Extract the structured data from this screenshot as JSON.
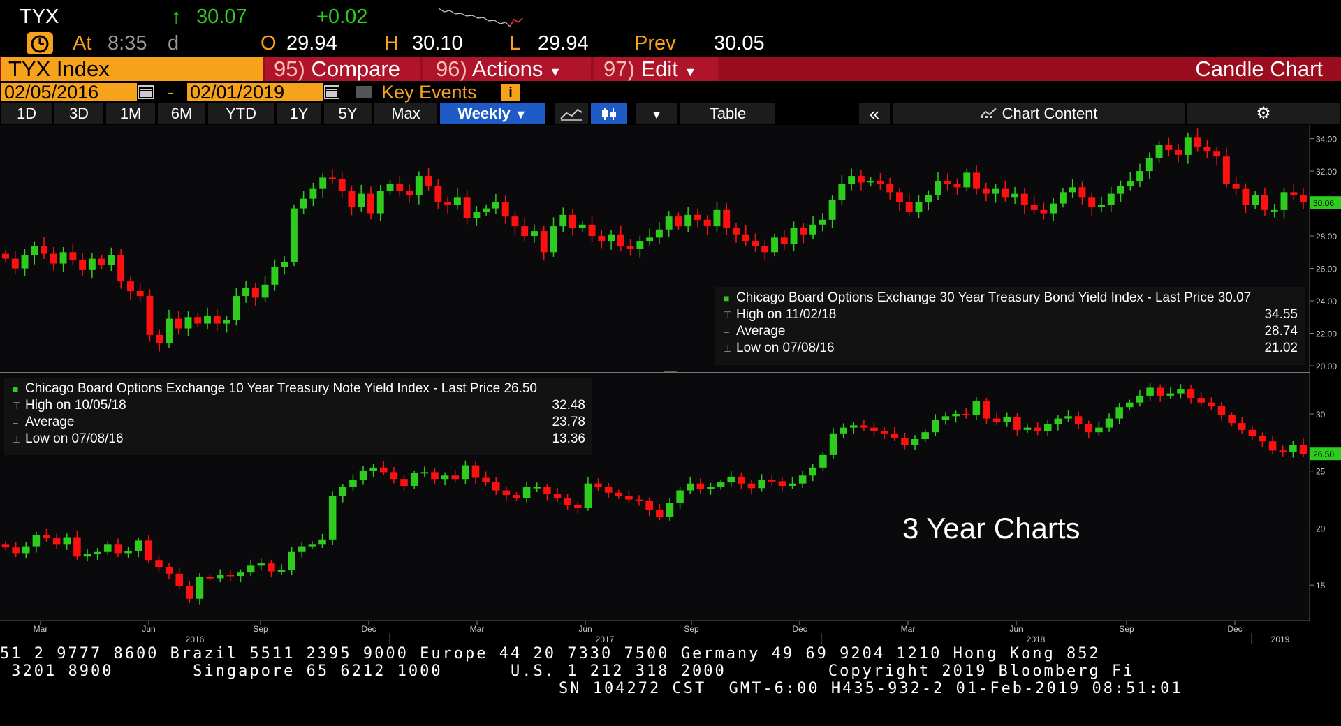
{
  "header": {
    "ticker": "TYX",
    "last_price": "30.07",
    "change": "+0.02",
    "at_label": "At",
    "time": "8:35",
    "time_suffix": "d",
    "open_label": "O",
    "open": "29.94",
    "high_label": "H",
    "high": "30.10",
    "low_label": "L",
    "low": "29.94",
    "prev_label": "Prev",
    "prev": "30.05"
  },
  "toolbar": {
    "security": "TYX Index",
    "compare_num": "95)",
    "compare": "Compare",
    "actions_num": "96)",
    "actions": "Actions",
    "edit_num": "97)",
    "edit": "Edit",
    "chart_type": "Candle Chart"
  },
  "daterange": {
    "start": "02/05/2016",
    "separator": "-",
    "end": "02/01/2019",
    "key_events": "Key Events"
  },
  "timeframes": [
    "1D",
    "3D",
    "1M",
    "6M",
    "YTD",
    "1Y",
    "5Y",
    "Max"
  ],
  "periodicity": "Weekly",
  "table_label": "Table",
  "chart_content_label": "Chart Content",
  "annotation": "3 Year Charts",
  "colors": {
    "up": "#2ecc1f",
    "down": "#ff1010",
    "accent": "#f7a21b",
    "bar_red": "#9b0d1e",
    "select_blue": "#1e5bc6"
  },
  "icons": [
    "up-arrow-icon",
    "clock-icon",
    "calendar-icon",
    "info-icon",
    "line-chart-icon",
    "candle-chart-icon",
    "chevron-down-icon",
    "double-chevron-left-icon",
    "chart-content-icon",
    "gear-icon"
  ],
  "chart_data": [
    {
      "type": "candlestick",
      "ylim": [
        20,
        34.5
      ],
      "yticks": [
        "34.00",
        "32.00",
        "30.00",
        "28.00",
        "26.00",
        "24.00",
        "22.00",
        "20.00"
      ],
      "last_label": "30.06",
      "legend": {
        "title": "Chicago Board Options Exchange 30 Year Treasury Bond Yield Index - Last Price 30.07",
        "high_label": "High on 11/02/18",
        "high": "34.55",
        "avg_label": "Average",
        "avg": "28.74",
        "low_label": "Low on 07/08/16",
        "low": "21.02"
      },
      "x_start": "2016-02-05",
      "close": [
        26.6,
        26.0,
        26.8,
        27.4,
        26.9,
        26.3,
        27.0,
        26.5,
        25.9,
        26.6,
        26.2,
        26.8,
        25.2,
        24.6,
        24.3,
        21.9,
        21.4,
        22.9,
        22.3,
        23.0,
        22.6,
        23.1,
        22.6,
        22.8,
        24.3,
        24.8,
        24.2,
        25.0,
        26.1,
        26.4,
        29.7,
        30.3,
        30.9,
        31.6,
        31.5,
        30.8,
        29.8,
        30.6,
        29.4,
        30.8,
        31.2,
        30.8,
        30.5,
        31.7,
        31.1,
        30.1,
        29.9,
        30.4,
        29.1,
        29.5,
        29.7,
        30.1,
        29.2,
        28.6,
        28.0,
        28.3,
        27.0,
        28.6,
        29.3,
        28.5,
        28.7,
        28.0,
        27.7,
        28.1,
        27.4,
        27.2,
        27.7,
        27.9,
        28.4,
        29.2,
        28.6,
        29.3,
        29.0,
        28.6,
        29.6,
        28.5,
        28.1,
        27.7,
        27.4,
        27.0,
        27.9,
        27.5,
        28.5,
        28.1,
        28.7,
        29.0,
        30.2,
        31.2,
        31.7,
        31.3,
        31.4,
        31.2,
        30.7,
        30.1,
        29.5,
        30.1,
        30.5,
        31.4,
        31.2,
        31.0,
        31.9,
        30.9,
        30.6,
        30.9,
        30.4,
        30.6,
        29.9,
        29.6,
        29.4,
        30.0,
        30.7,
        31.0,
        30.4,
        29.8,
        29.9,
        30.6,
        31.1,
        31.4,
        32.0,
        32.8,
        33.6,
        33.3,
        33.0,
        34.1,
        33.5,
        33.2,
        32.9,
        31.2,
        30.9,
        29.9,
        30.5,
        29.6,
        29.6,
        30.7,
        30.5,
        30.07
      ]
    },
    {
      "type": "candlestick",
      "ylim": [
        12.5,
        33
      ],
      "yticks": [
        "30",
        "25",
        "20",
        "15"
      ],
      "last_label": "26.50",
      "legend": {
        "title": "Chicago Board Options Exchange 10 Year Treasury Note Yield Index - Last Price 26.50",
        "high_label": "High on 10/05/18",
        "high": "32.48",
        "avg_label": "Average",
        "avg": "23.78",
        "low_label": "Low on 07/08/16",
        "low": "13.36"
      },
      "x_start": "2016-02-05",
      "close": [
        18.3,
        17.8,
        18.4,
        19.4,
        19.1,
        18.6,
        19.2,
        17.5,
        17.7,
        17.9,
        18.6,
        17.8,
        18.0,
        18.9,
        17.2,
        16.6,
        16.0,
        14.9,
        13.8,
        15.7,
        15.6,
        15.9,
        15.8,
        16.1,
        16.7,
        16.9,
        16.2,
        16.3,
        17.9,
        18.4,
        18.6,
        19.0,
        22.8,
        23.6,
        24.2,
        25.0,
        25.3,
        24.9,
        24.3,
        23.7,
        24.8,
        24.9,
        24.3,
        24.6,
        24.3,
        25.5,
        24.4,
        24.0,
        23.3,
        22.9,
        22.6,
        23.6,
        23.6,
        23.0,
        22.6,
        22.0,
        21.8,
        23.9,
        23.6,
        23.1,
        22.8,
        22.5,
        22.4,
        21.6,
        21.0,
        22.2,
        23.3,
        23.9,
        23.4,
        23.6,
        24.0,
        24.5,
        23.9,
        23.5,
        24.2,
        24.1,
        23.7,
        23.9,
        24.6,
        25.3,
        26.4,
        28.3,
        28.8,
        29.0,
        28.8,
        28.5,
        28.3,
        27.9,
        27.3,
        27.8,
        28.4,
        29.5,
        29.8,
        30.0,
        29.9,
        31.1,
        29.6,
        29.3,
        29.7,
        28.6,
        28.8,
        28.5,
        29.1,
        29.6,
        29.8,
        29.1,
        28.4,
        28.8,
        29.6,
        30.6,
        31.0,
        31.6,
        32.3,
        31.6,
        31.8,
        32.2,
        31.4,
        31.0,
        30.7,
        29.9,
        29.2,
        28.6,
        28.1,
        27.6,
        26.8,
        26.7,
        27.3,
        26.5
      ]
    }
  ],
  "xaxis": {
    "months": [
      "Mar",
      "Jun",
      "Sep",
      "Dec",
      "Mar",
      "Jun",
      "Sep",
      "Dec",
      "Mar",
      "Jun",
      "Sep",
      "Dec"
    ],
    "years": [
      "2016",
      "2017",
      "2018",
      "2019"
    ]
  },
  "footer": {
    "line1": "51 2 9777 8600 Brazil 5511 2395 9000 Europe 44 20 7330 7500 Germany 49 69 9204 1210 Hong Kong 852",
    "line2": " 3201 8900       Singapore 65 6212 1000      U.S. 1 212 318 2000         Copyright 2019 Bloomberg Fi",
    "line3": "SN 104272 CST  GMT-6:00 H435-932-2 01-Feb-2019 08:51:01"
  }
}
